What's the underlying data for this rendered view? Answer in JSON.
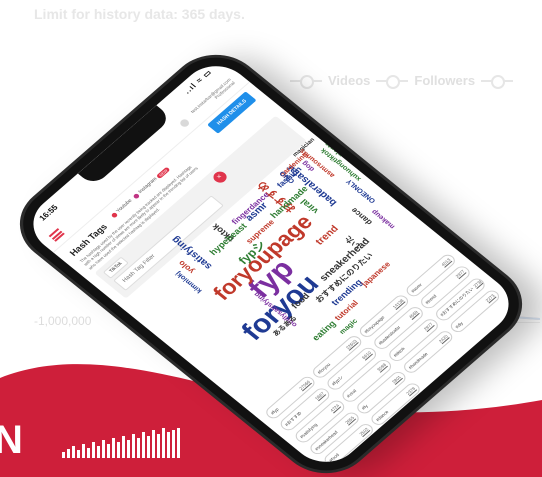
{
  "background": {
    "limit_text": "Limit for history data: 365 days.",
    "tabs": [
      "Videos",
      "Followers"
    ],
    "axis_label": "-1,000,000",
    "brand_text": "N"
  },
  "status_bar": {
    "time": "16:55",
    "icons": "..ıl ≈ ▭"
  },
  "header": {
    "user_email": "test.instarbar@gmail.com",
    "user_plan": "Professional"
  },
  "page": {
    "title": "Hash Tags",
    "platforms": [
      {
        "label": "Youtube",
        "color": "#e0344b"
      },
      {
        "label": "Instagram",
        "color": "#c13584",
        "badge": "NEW"
      }
    ],
    "details_button": "HASH DETAILS",
    "description": "The hashtags used by the user recently being tracked are displayed. Hashtags with a high number of views are more likely to appear in the trending list of users who have used the selected hashtag is displayed."
  },
  "filter": {
    "platform_chip": "TikTok",
    "placeholder": "Hash Tag Filter",
    "clear_icon": "close-icon"
  },
  "word_cloud": [
    {
      "text": "fyp",
      "color": "#7b2fa0"
    },
    {
      "text": "foryou",
      "color": "#1f3a93"
    },
    {
      "text": "foryoupage",
      "color": "#c0392b"
    },
    {
      "text": "fypシ",
      "color": "#2e7d32"
    },
    {
      "text": "おすすめ",
      "color": "#c0392b"
    },
    {
      "text": "trend",
      "color": "#c0392b"
    },
    {
      "text": "viral",
      "color": "#2e7d32"
    },
    {
      "text": "baderalsafar",
      "color": "#1f3a93"
    },
    {
      "text": "sneakerhead",
      "color": "#333333"
    },
    {
      "text": "food",
      "color": "#333333"
    },
    {
      "text": "おすすめにのりたい",
      "color": "#333333"
    },
    {
      "text": "trending",
      "color": "#1f3a93"
    },
    {
      "text": "tutorial",
      "color": "#c0392b"
    },
    {
      "text": "japanese",
      "color": "#c0392b"
    },
    {
      "text": "magic",
      "color": "#2e7d32"
    },
    {
      "text": "eating",
      "color": "#2e7d32"
    },
    {
      "text": "いた",
      "color": "#333333"
    },
    {
      "text": "oddlysatisfying",
      "color": "#7b2fa0"
    },
    {
      "text": "あるある",
      "color": "#333333"
    },
    {
      "text": "satisfying",
      "color": "#1f3a93"
    },
    {
      "text": "tiktok",
      "color": "#333333"
    },
    {
      "text": "asmr",
      "color": "#1f3a93"
    },
    {
      "text": "handmade",
      "color": "#2e7d32"
    },
    {
      "text": "supreme",
      "color": "#c0392b"
    },
    {
      "text": "hypebeast",
      "color": "#2e7d32"
    },
    {
      "text": "fingerdance",
      "color": "#7b2fa0"
    },
    {
      "text": "fashion",
      "color": "#1f3a93"
    },
    {
      "text": "gardening",
      "color": "#c0392b"
    },
    {
      "text": "magician",
      "color": "#333333"
    },
    {
      "text": "ONO",
      "color": "#1f3a93"
    },
    {
      "text": "yolo",
      "color": "#c0392b"
    },
    {
      "text": "dance",
      "color": "#333333"
    },
    {
      "text": "makeup",
      "color": "#7b2fa0"
    },
    {
      "text": "ONEONLY",
      "color": "#1f3a93"
    },
    {
      "text": "xuhuongtiktok",
      "color": "#2e7d32"
    },
    {
      "text": "asmrsounds",
      "color": "#c0392b"
    },
    {
      "text": "plants",
      "color": "#2e7d32"
    },
    {
      "text": "dog",
      "color": "#7b2fa0"
    },
    {
      "text": "kimmiokj",
      "color": "#1f3a93"
    }
  ],
  "tag_counts": [
    {
      "tag": "#fyp",
      "count": "27066"
    },
    {
      "tag": "#foryou",
      "count": "22603"
    },
    {
      "tag": "#foryoupage",
      "count": "14138"
    },
    {
      "tag": "#asmr",
      "count": "4513"
    },
    {
      "tag": "#おすすめ",
      "count": "5667"
    },
    {
      "tag": "#fypシ",
      "count": "6610"
    },
    {
      "tag": "#baderalsafar",
      "count": "4569"
    },
    {
      "tag": "#trend",
      "count": "2977"
    },
    {
      "tag": "#satisfying",
      "count": "4724"
    },
    {
      "tag": "#viral",
      "count": "3598"
    },
    {
      "tag": "#tiktok",
      "count": "2977"
    },
    {
      "tag": "#おすすめにのりたい",
      "count": "2738"
    },
    {
      "tag": "#sneakerhead",
      "count": "2655"
    },
    {
      "tag": "#fy",
      "count": "2801"
    },
    {
      "tag": "#handmade",
      "count": "2420"
    },
    {
      "tag": "#diy",
      "count": "2273"
    },
    {
      "tag": "#food",
      "count": "2502"
    },
    {
      "tag": "#dance",
      "count": "2379"
    }
  ]
}
